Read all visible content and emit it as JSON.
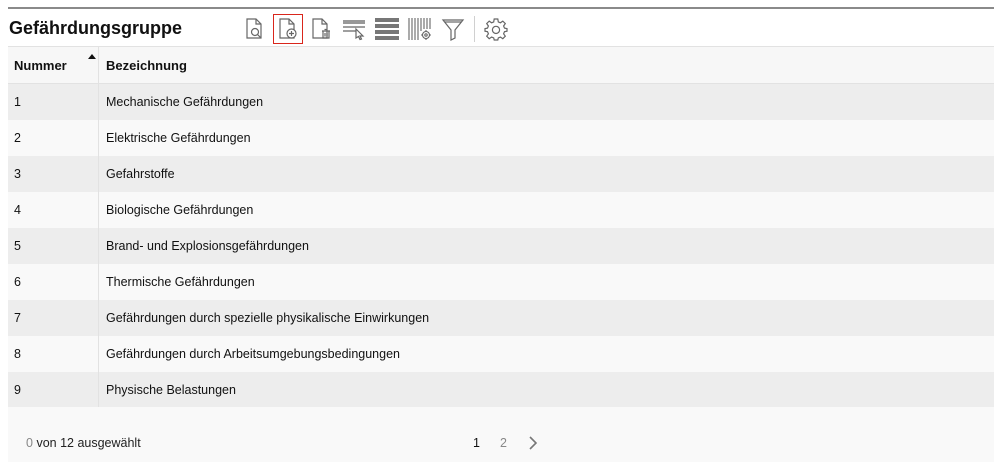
{
  "header": {
    "title": "Gefährdungsgruppe"
  },
  "toolbar": {
    "icons": [
      "document-search-icon",
      "document-add-icon",
      "document-delete-icon",
      "row-select-icon",
      "rows-icon",
      "columns-settings-icon",
      "filter-icon",
      "gear-icon"
    ],
    "active_color": "#d9261c"
  },
  "table": {
    "columns": [
      "Nummer",
      "Bezeichnung"
    ],
    "rows": [
      {
        "nummer": "1",
        "bezeichnung": "Mechanische Gefährdungen"
      },
      {
        "nummer": "2",
        "bezeichnung": "Elektrische Gefährdungen"
      },
      {
        "nummer": "3",
        "bezeichnung": "Gefahrstoffe"
      },
      {
        "nummer": "4",
        "bezeichnung": "Biologische Gefährdungen"
      },
      {
        "nummer": "5",
        "bezeichnung": "Brand- und Explosionsgefährdungen"
      },
      {
        "nummer": "6",
        "bezeichnung": "Thermische Gefährdungen"
      },
      {
        "nummer": "7",
        "bezeichnung": "Gefährdungen durch spezielle physikalische Einwirkungen"
      },
      {
        "nummer": "8",
        "bezeichnung": "Gefährdungen durch Arbeitsumgebungsbedingungen"
      },
      {
        "nummer": "9",
        "bezeichnung": "Physische Belastungen"
      }
    ]
  },
  "footer": {
    "selected_count": "0",
    "selection_text": "von 12 ausgewählt",
    "pages": [
      "1",
      "2"
    ],
    "current_page": "1"
  }
}
